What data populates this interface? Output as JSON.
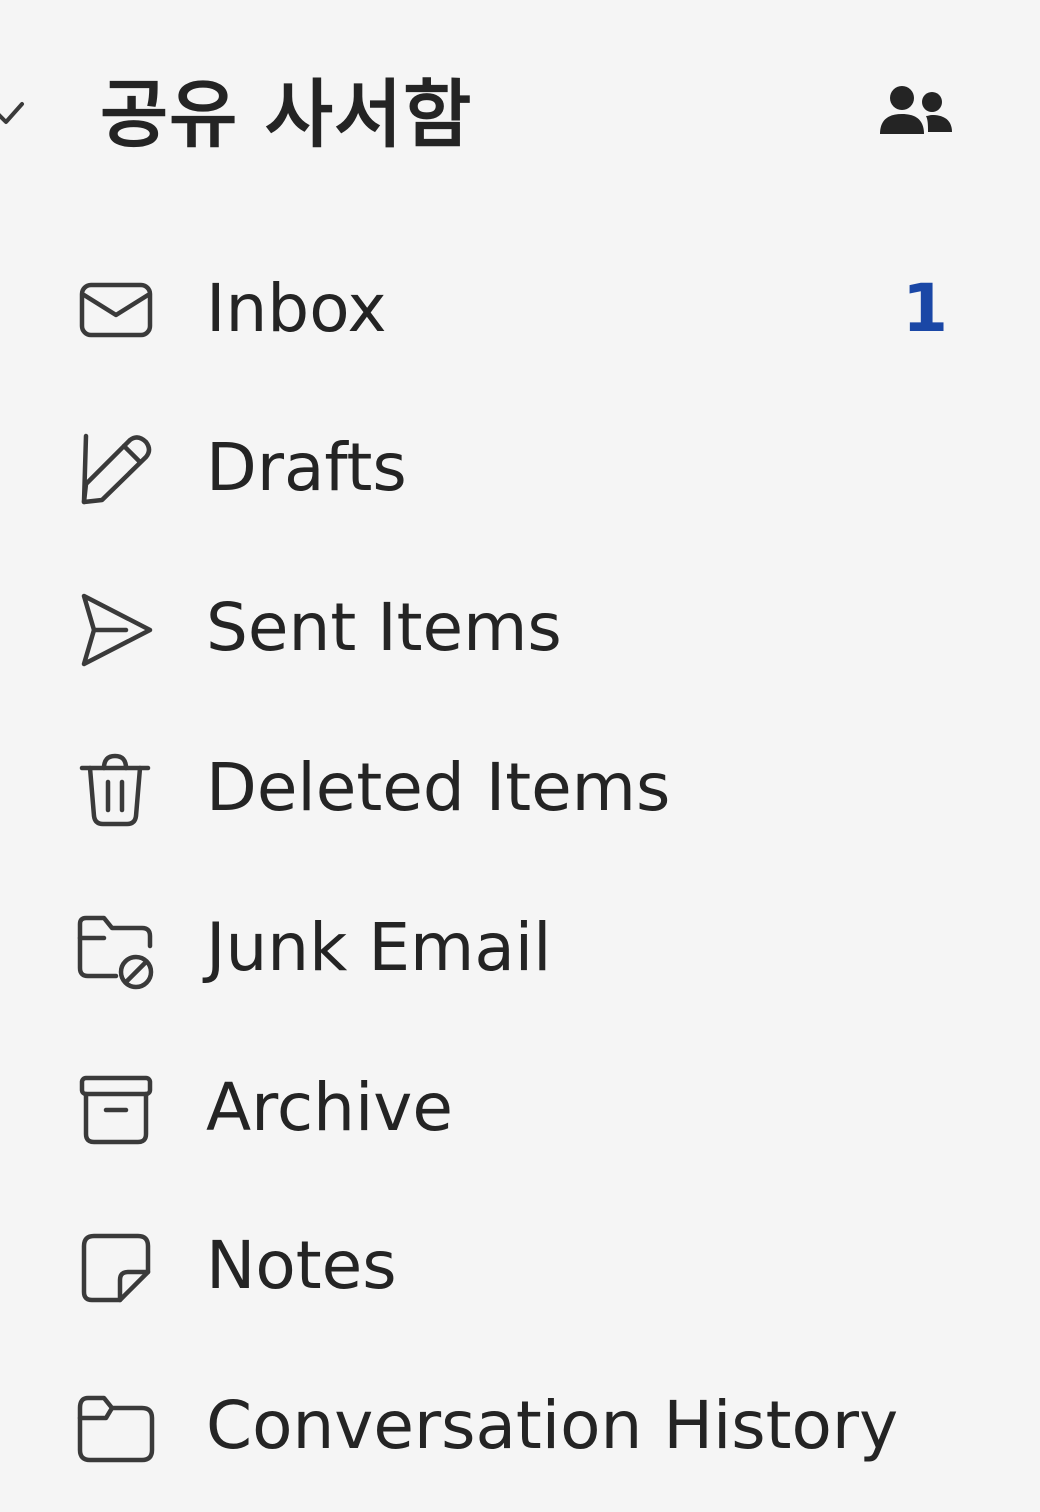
{
  "group": {
    "title": "공유 사서함",
    "expanded": true,
    "chevron_icon": "chevron-down-icon",
    "people_icon": "people-icon"
  },
  "colors": {
    "background": "#f5f5f5",
    "text": "#242424",
    "unread_count": "#1a47a6"
  },
  "folders": [
    {
      "label": "Inbox",
      "count": "1",
      "icon": "mail-icon"
    },
    {
      "label": "Drafts",
      "count": "",
      "icon": "pencil-icon"
    },
    {
      "label": "Sent Items",
      "count": "",
      "icon": "send-icon"
    },
    {
      "label": "Deleted Items",
      "count": "",
      "icon": "trash-icon"
    },
    {
      "label": "Junk Email",
      "count": "",
      "icon": "junk-folder-icon"
    },
    {
      "label": "Archive",
      "count": "",
      "icon": "archive-icon"
    },
    {
      "label": "Notes",
      "count": "",
      "icon": "note-icon"
    },
    {
      "label": "Conversation History",
      "count": "",
      "icon": "folder-icon"
    }
  ]
}
